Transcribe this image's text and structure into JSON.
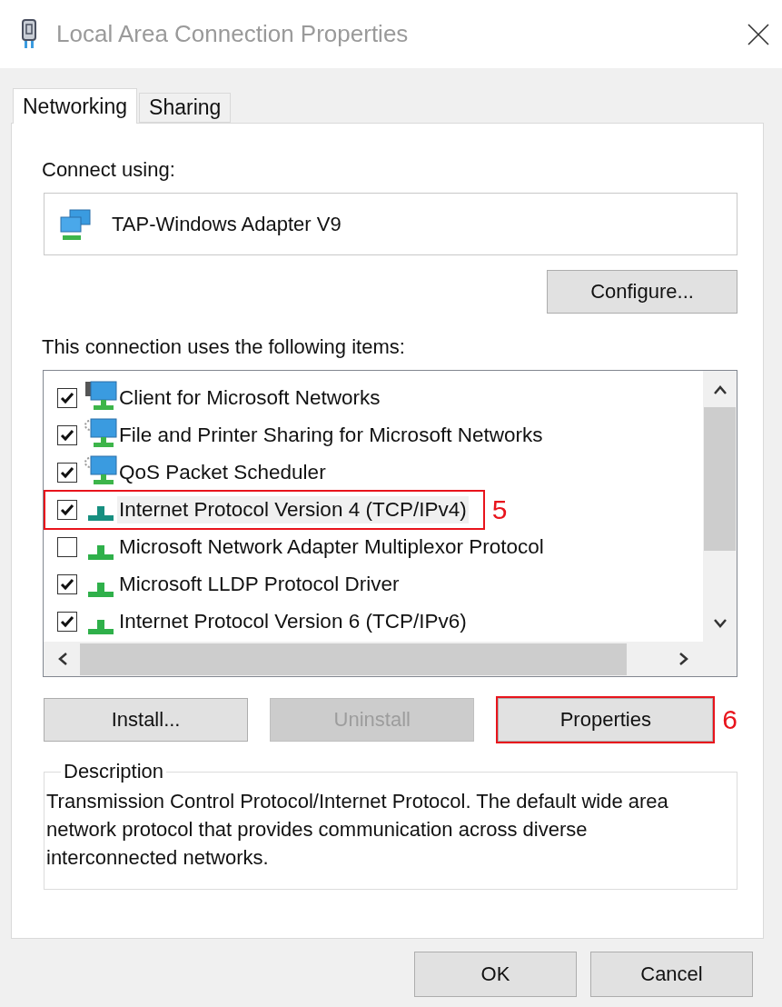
{
  "window": {
    "title": "Local Area Connection Properties"
  },
  "tabs": [
    {
      "label": "Networking",
      "selected": true
    },
    {
      "label": "Sharing",
      "selected": false
    }
  ],
  "connect_label": "Connect using:",
  "adapter": "TAP-Windows Adapter V9",
  "configure_button": "Configure...",
  "items_label": "This connection uses the following items:",
  "items": [
    {
      "label": "Client for Microsoft Networks",
      "kind": "client",
      "checked": true,
      "selected": false
    },
    {
      "label": "File and Printer Sharing for Microsoft Networks",
      "kind": "service",
      "checked": true,
      "selected": false
    },
    {
      "label": "QoS Packet Scheduler",
      "kind": "service",
      "checked": true,
      "selected": false
    },
    {
      "label": "Internet Protocol Version 4 (TCP/IPv4)",
      "kind": "protocol",
      "checked": true,
      "selected": true,
      "callout": "5"
    },
    {
      "label": "Microsoft Network Adapter Multiplexor Protocol",
      "kind": "protocol",
      "checked": false,
      "selected": false
    },
    {
      "label": "Microsoft LLDP Protocol Driver",
      "kind": "protocol",
      "checked": true,
      "selected": false
    },
    {
      "label": "Internet Protocol Version 6 (TCP/IPv6)",
      "kind": "protocol",
      "checked": true,
      "selected": false
    }
  ],
  "buttons": [
    {
      "label": "Install...",
      "disabled": false
    },
    {
      "label": "Uninstall",
      "disabled": true
    },
    {
      "label": "Properties",
      "disabled": false,
      "callout": "6"
    }
  ],
  "description": {
    "title": "Description",
    "text": "Transmission Control Protocol/Internet Protocol. The default wide area network protocol that provides communication across diverse interconnected networks."
  },
  "dialog_buttons": [
    "OK",
    "Cancel"
  ]
}
